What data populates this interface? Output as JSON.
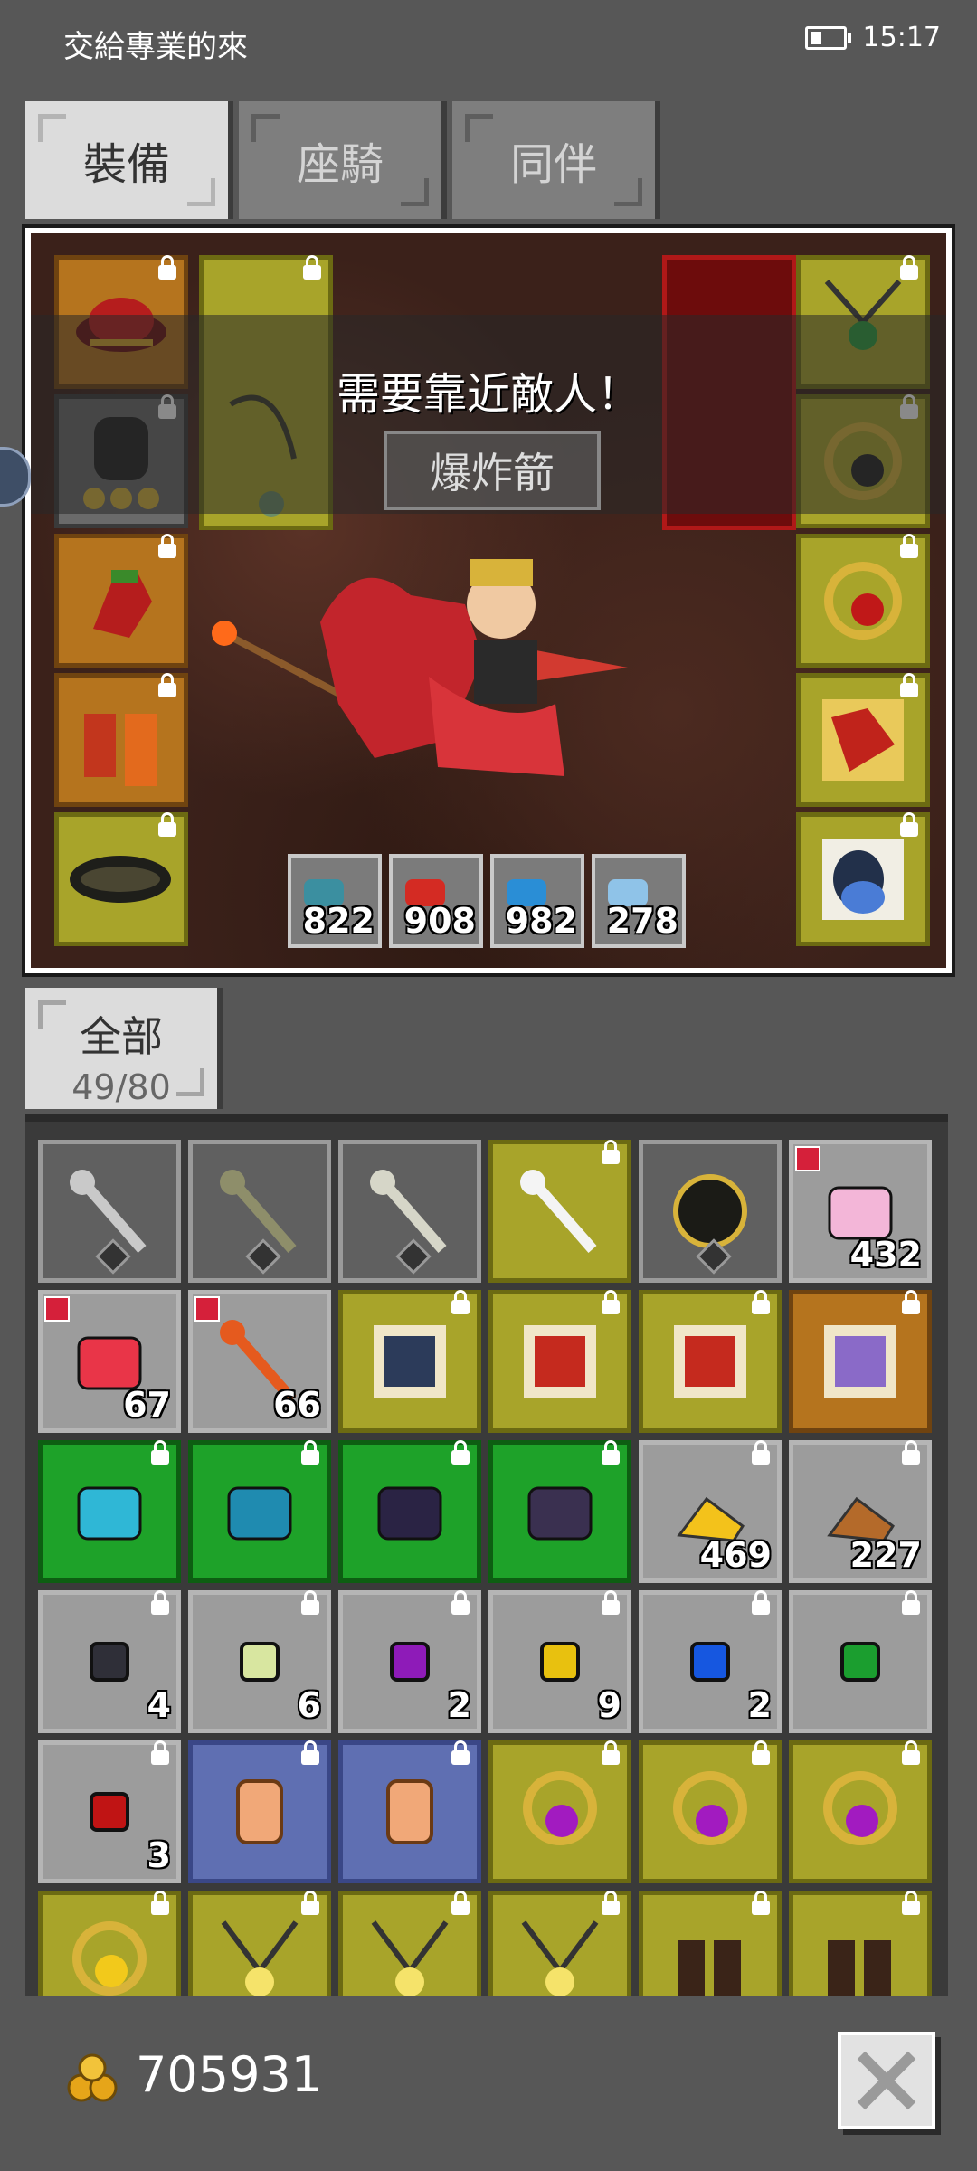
{
  "status_bar": {
    "carrier_text": "交給專業的來",
    "time": "15:17"
  },
  "tabs": [
    {
      "label": "裝備",
      "active": true
    },
    {
      "label": "座騎",
      "active": false
    },
    {
      "label": "同伴",
      "active": false
    }
  ],
  "toast": {
    "message": "需要靠近敵人！",
    "skill_button": "爆炸箭"
  },
  "stats": [
    "822",
    "908",
    "982",
    "278"
  ],
  "category_tab": {
    "label": "全部",
    "count": "49/80"
  },
  "inventory": [
    {
      "style": "dark",
      "qty": "",
      "icon": "battle-axe-icon"
    },
    {
      "style": "dark",
      "qty": "",
      "icon": "mace-icon"
    },
    {
      "style": "dark",
      "qty": "",
      "icon": "sword-icon"
    },
    {
      "style": "olive",
      "qty": "",
      "icon": "bow-icon"
    },
    {
      "style": "dark",
      "qty": "",
      "icon": "orb-icon"
    },
    {
      "style": "plain",
      "qty": "432",
      "icon": "pink-cake-icon"
    },
    {
      "style": "plain",
      "qty": "67",
      "icon": "gift-box-icon"
    },
    {
      "style": "plain",
      "qty": "66",
      "icon": "torch-icon"
    },
    {
      "style": "olive",
      "qty": "",
      "icon": "penguin-card-icon"
    },
    {
      "style": "olive",
      "qty": "",
      "icon": "dragon-card-icon"
    },
    {
      "style": "olive",
      "qty": "",
      "icon": "dragon-card-icon"
    },
    {
      "style": "orange",
      "qty": "",
      "icon": "unicorn-card-icon"
    },
    {
      "style": "green",
      "qty": "",
      "icon": "belt-icon"
    },
    {
      "style": "green",
      "qty": "",
      "icon": "armor-icon"
    },
    {
      "style": "green",
      "qty": "",
      "icon": "hat-icon"
    },
    {
      "style": "green",
      "qty": "",
      "icon": "glove-icon"
    },
    {
      "style": "plain",
      "qty": "469",
      "icon": "gold-ore-icon"
    },
    {
      "style": "plain",
      "qty": "227",
      "icon": "copper-ore-icon"
    },
    {
      "style": "plain",
      "qty": "4",
      "icon": "black-gem-icon"
    },
    {
      "style": "plain",
      "qty": "6",
      "icon": "pale-gem-icon"
    },
    {
      "style": "plain",
      "qty": "2",
      "icon": "purple-gem-icon"
    },
    {
      "style": "plain",
      "qty": "9",
      "icon": "yellow-gem-icon"
    },
    {
      "style": "plain",
      "qty": "2",
      "icon": "blue-gem-icon"
    },
    {
      "style": "plain",
      "qty": "",
      "icon": "green-gem-icon"
    },
    {
      "style": "plain",
      "qty": "3",
      "icon": "red-gem-icon"
    },
    {
      "style": "blue",
      "qty": "",
      "icon": "scroll-icon"
    },
    {
      "style": "blue",
      "qty": "",
      "icon": "small-scroll-icon"
    },
    {
      "style": "olive",
      "qty": "",
      "icon": "purple-ring-icon"
    },
    {
      "style": "olive",
      "qty": "",
      "icon": "purple-ring-icon"
    },
    {
      "style": "olive",
      "qty": "",
      "icon": "purple-ring-icon"
    },
    {
      "style": "olive",
      "qty": "",
      "icon": "gold-ring-icon"
    },
    {
      "style": "olive",
      "qty": "",
      "icon": "necklace-icon"
    },
    {
      "style": "olive",
      "qty": "",
      "icon": "necklace-icon"
    },
    {
      "style": "olive",
      "qty": "",
      "icon": "necklace-icon"
    },
    {
      "style": "olive",
      "qty": "",
      "icon": "boots-icon"
    },
    {
      "style": "olive",
      "qty": "",
      "icon": "boots-icon"
    }
  ],
  "footer": {
    "gold": "705931"
  }
}
